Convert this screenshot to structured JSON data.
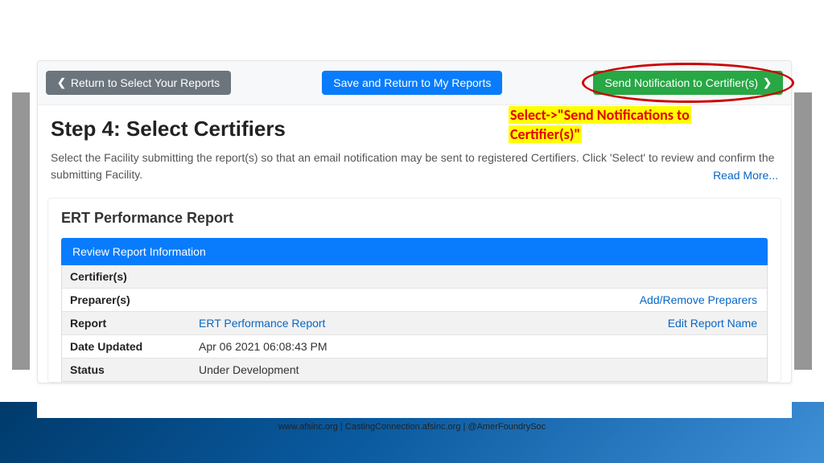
{
  "toolbar": {
    "back_label": "Return to Select Your Reports",
    "save_label": "Save and Return to My Reports",
    "send_label": "Send Notification to Certifier(s)"
  },
  "step": {
    "title": "Step 4: Select Certifiers",
    "desc": "Select the Facility submitting the report(s) so that an email notification may be sent to registered Certifiers. Click 'Select' to review and confirm the submitting Facility.",
    "read_more": "Read More..."
  },
  "annotation": {
    "line1": "Select->\"Send Notifications to",
    "line2": "Certifier(s)\""
  },
  "report": {
    "section_title": "ERT Performance Report",
    "review_header": "Review Report Information",
    "rows": {
      "certifiers_label": "Certifier(s)",
      "preparers_label": "Preparer(s)",
      "preparers_action": "Add/Remove Preparers",
      "report_label": "Report",
      "report_value": "ERT Performance Report",
      "report_action": "Edit Report Name",
      "date_label": "Date Updated",
      "date_value": "Apr 06 2021 06:08:43 PM",
      "status_label": "Status",
      "status_value": "Under Development"
    }
  },
  "footer": {
    "text": "www.afsinc.org  | CastingConnection.afsinc.org | @AmerFoundrySoc"
  }
}
